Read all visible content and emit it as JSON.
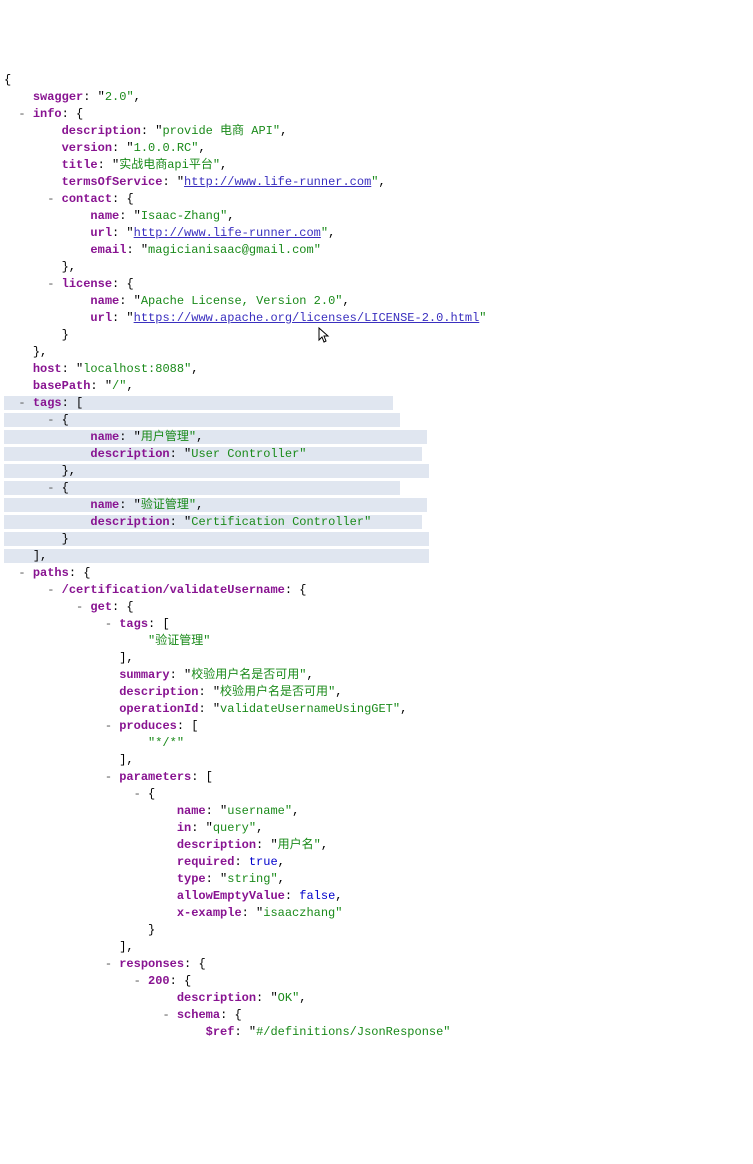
{
  "swagger_key": "swagger",
  "swagger_val": "2.0",
  "info_key": "info",
  "description_key": "description",
  "description_val": "provide 电商 API",
  "version_key": "version",
  "version_val": "1.0.0.RC",
  "title_key": "title",
  "title_val": "实战电商api平台",
  "termsOfService_key": "termsOfService",
  "termsOfService_val": "http://www.life-runner.com",
  "contact_key": "contact",
  "contact_name_key": "name",
  "contact_name_val": "Isaac-Zhang",
  "contact_url_key": "url",
  "contact_url_val": "http://www.life-runner.com",
  "contact_email_key": "email",
  "contact_email_val": "magicianisaac@gmail.com",
  "license_key": "license",
  "license_name_key": "name",
  "license_name_val": "Apache License, Version 2.0",
  "license_url_key": "url",
  "license_url_val": "https://www.apache.org/licenses/LICENSE-2.0.html",
  "host_key": "host",
  "host_val": "localhost:8088",
  "basePath_key": "basePath",
  "basePath_val": "/",
  "tags_key": "tags",
  "tag0_name_key": "name",
  "tag0_name_val": "用户管理",
  "tag0_desc_key": "description",
  "tag0_desc_val": "User Controller",
  "tag1_name_key": "name",
  "tag1_name_val": "验证管理",
  "tag1_desc_key": "description",
  "tag1_desc_val": "Certification Controller",
  "paths_key": "paths",
  "path0_key": "/certification/validateUsername",
  "get_key": "get",
  "get_tags_key": "tags",
  "get_tags_val0": "验证管理",
  "summary_key": "summary",
  "summary_val": "校验用户名是否可用",
  "get_desc_key": "description",
  "get_desc_val": "校验用户名是否可用",
  "operationId_key": "operationId",
  "operationId_val": "validateUsernameUsingGET",
  "produces_key": "produces",
  "produces_val0": "*/*",
  "parameters_key": "parameters",
  "param_name_key": "name",
  "param_name_val": "username",
  "param_in_key": "in",
  "param_in_val": "query",
  "param_desc_key": "description",
  "param_desc_val": "用户名",
  "param_required_key": "required",
  "param_required_val": "true",
  "param_type_key": "type",
  "param_type_val": "string",
  "param_allowEmpty_key": "allowEmptyValue",
  "param_allowEmpty_val": "false",
  "param_xexample_key": "x-example",
  "param_xexample_val": "isaaczhang",
  "responses_key": "responses",
  "resp200_key": "200",
  "resp200_desc_key": "description",
  "resp200_desc_val": "OK",
  "schema_key": "schema",
  "ref_key": "$ref",
  "ref_val": "#/definitions/JsonResponse"
}
